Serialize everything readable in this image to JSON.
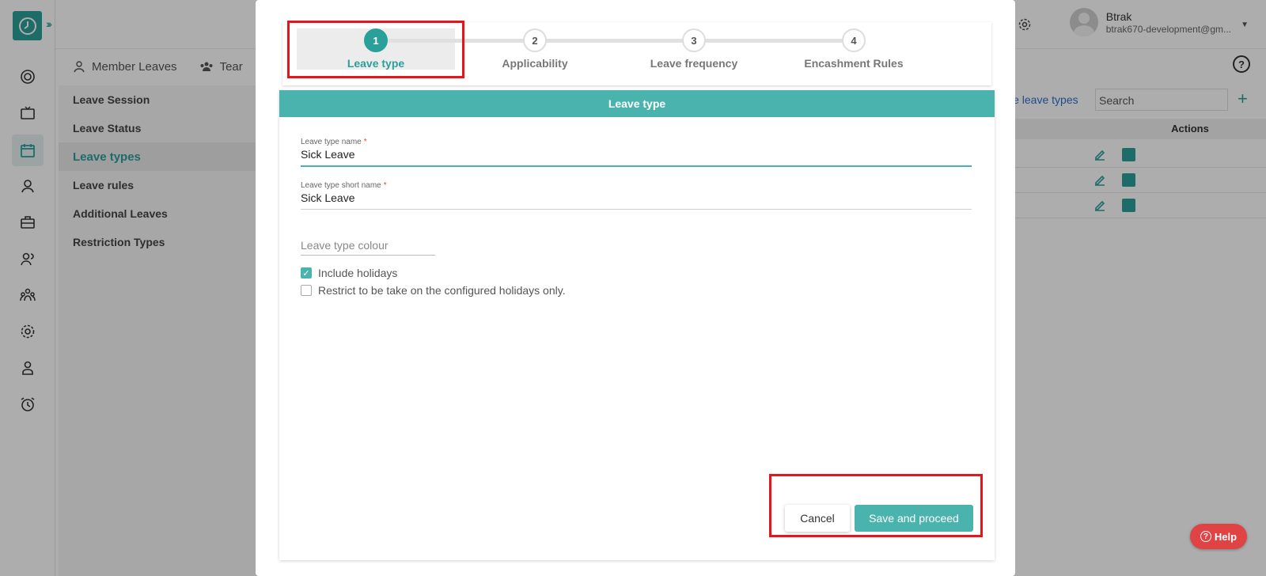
{
  "header": {
    "user_name": "Btrak",
    "user_email": "btrak670-development@gm..."
  },
  "tabs": [
    {
      "label": "Member Leaves"
    },
    {
      "label": "Tear"
    }
  ],
  "left_nav": [
    {
      "label": "Leave Session"
    },
    {
      "label": "Leave Status"
    },
    {
      "label": "Leave types"
    },
    {
      "label": "Leave rules"
    },
    {
      "label": "Additional Leaves"
    },
    {
      "label": "Restriction Types"
    }
  ],
  "right_pane": {
    "link": "ive leave types",
    "search_placeholder": "Search",
    "actions_header": "Actions"
  },
  "stepper": [
    {
      "number": "1",
      "label": "Leave type"
    },
    {
      "number": "2",
      "label": "Applicability"
    },
    {
      "number": "3",
      "label": "Leave frequency"
    },
    {
      "number": "4",
      "label": "Encashment Rules"
    }
  ],
  "form": {
    "title": "Leave type",
    "name_label": "Leave type name",
    "name_value": "Sick Leave",
    "short_label": "Leave type short name",
    "short_value": "Sick Leave",
    "required_mark": "*",
    "colour_placeholder": "Leave type colour",
    "include_holidays": {
      "label": "Include holidays",
      "checked": true
    },
    "restrict_holidays": {
      "label": "Restrict to be take on the configured holidays only.",
      "checked": false
    },
    "cancel_label": "Cancel",
    "save_label": "Save and proceed"
  },
  "help": {
    "label": "Help"
  },
  "colors": {
    "accent": "#2b9f9a",
    "header_teal": "#4bb3ad",
    "highlight": "#e8141c",
    "help_red": "#e04343"
  }
}
